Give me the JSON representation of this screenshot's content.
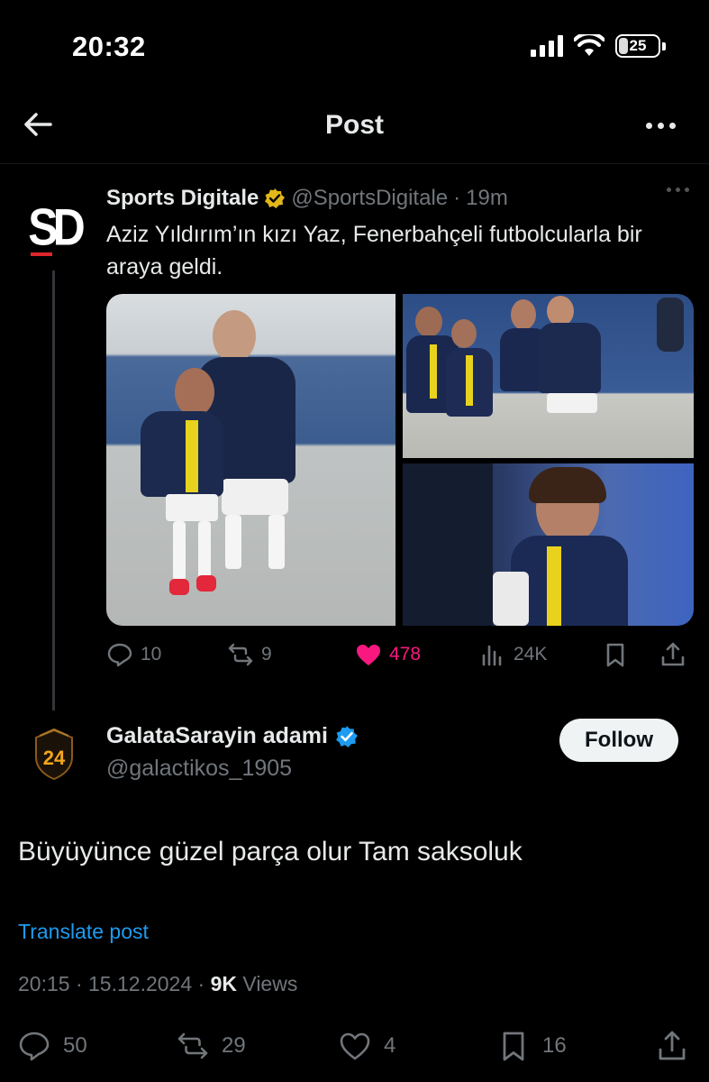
{
  "status_bar": {
    "time": "20:32",
    "battery": "25"
  },
  "header": {
    "title": "Post"
  },
  "quoted_post": {
    "author_name": "Sports Digitale",
    "handle": "@SportsDigitale",
    "separator": "·",
    "age": "19m",
    "avatar_text": "SD",
    "text": "Aziz Yıldırım’ın kızı Yaz, Fenerbahçeli futbolcularla bir araya geldi.",
    "actions": {
      "replies": "10",
      "reposts": "9",
      "likes": "478",
      "views": "24K"
    }
  },
  "reply_post": {
    "author_name": "GalataSarayin adami",
    "handle": "@galactikos_1905",
    "avatar_text": "24",
    "follow_label": "Follow",
    "text": "Büyüyünce güzel parça olur Tam saksoluk",
    "translate_label": "Translate post",
    "time": "20:15",
    "date": "15.12.2024",
    "views_count": "9K",
    "views_label": "Views",
    "actions": {
      "replies": "50",
      "reposts": "29",
      "likes": "4",
      "bookmarks": "16"
    }
  },
  "colors": {
    "accent": "#1d9bf0",
    "like": "#f91880",
    "muted": "#71767b",
    "verified_gold": "#e2b719"
  }
}
